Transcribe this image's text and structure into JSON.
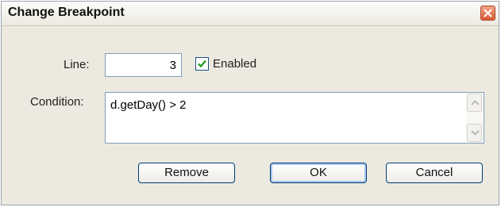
{
  "dialog": {
    "title": "Change Breakpoint",
    "close_icon": "close-icon"
  },
  "form": {
    "line_label": "Line:",
    "line_value": "3",
    "enabled_label": "Enabled",
    "enabled_checked": true,
    "condition_label": "Condition:",
    "condition_value": "d.getDay() > 2"
  },
  "buttons": {
    "remove": "Remove",
    "ok": "OK",
    "cancel": "Cancel"
  },
  "colors": {
    "accent": "#1c5180",
    "close": "#d75b36",
    "check": "#21a121"
  }
}
